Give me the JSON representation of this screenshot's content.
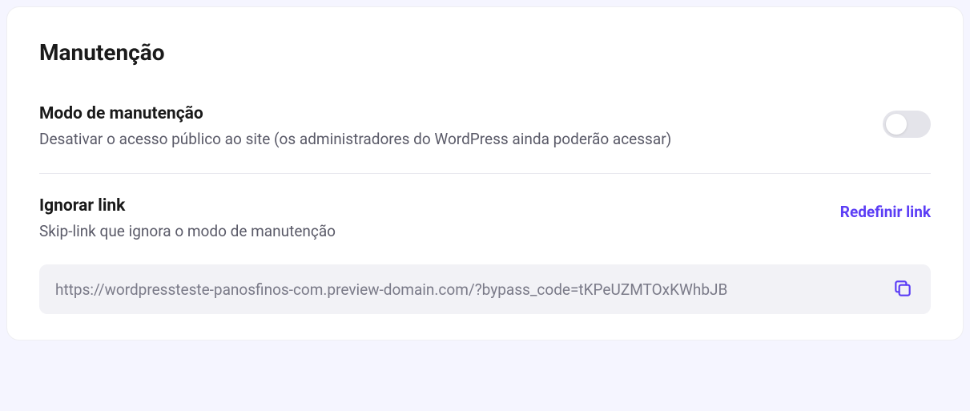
{
  "card": {
    "title": "Manutenção"
  },
  "maintenanceMode": {
    "title": "Modo de manutenção",
    "description": "Desativar o acesso público ao site (os administradores do WordPress ainda poderão acessar)",
    "enabled": false
  },
  "ignoreLink": {
    "title": "Ignorar link",
    "description": "Skip-link que ignora o modo de manutenção",
    "resetLabel": "Redefinir link",
    "url": "https://wordpressteste-panosfinos-com.preview-domain.com/?bypass_code=tKPeUZMTOxKWhbJB"
  },
  "colors": {
    "accent": "#5b3df5",
    "textPrimary": "#1a1a1a",
    "textSecondary": "#5a5a68",
    "textMuted": "#7a7a88",
    "panelBg": "#f2f2f6",
    "toggleOff": "#e4e4ea"
  }
}
